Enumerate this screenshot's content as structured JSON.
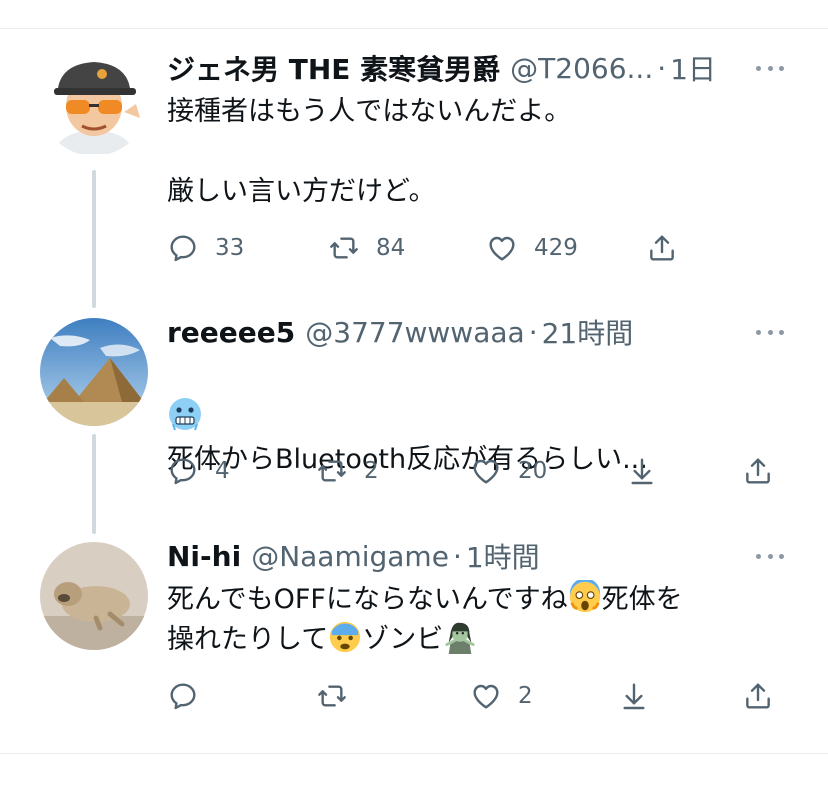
{
  "tweets": [
    {
      "name": "ジェネ男 THE 素寒貧男爵",
      "handle": "@T2066...",
      "sep": "·",
      "time": "1日",
      "text": "接種者はもう人ではないんだよ。\n\n厳しい言い方だけど。",
      "reply_count": "33",
      "retweet_count": "84",
      "like_count": "429"
    },
    {
      "name": "reeeee5",
      "handle": "@3777wwwaaa",
      "sep": "·",
      "time": "21時間",
      "line1_emoji": "cold-face-emoji",
      "text": "死体からBluetooth反応が有るらしい...",
      "reply_count": "4",
      "retweet_count": "2",
      "like_count": "20"
    },
    {
      "name": "Ni-hi",
      "handle": "@Naamigame",
      "sep": "·",
      "time": "1時間",
      "text1": "死んでもOFFにならないんですね",
      "text2": "死体を",
      "text3": "操れたりして",
      "text4": "ゾンビ",
      "emoji1": "screaming-face-emoji",
      "emoji2": "fearful-face-emoji",
      "emoji3": "zombie-emoji",
      "reply_count": "",
      "retweet_count": "",
      "like_count": "2"
    }
  ],
  "colors": {
    "text": "#0f1419",
    "muted": "#536471",
    "line": "#cfd9de"
  }
}
